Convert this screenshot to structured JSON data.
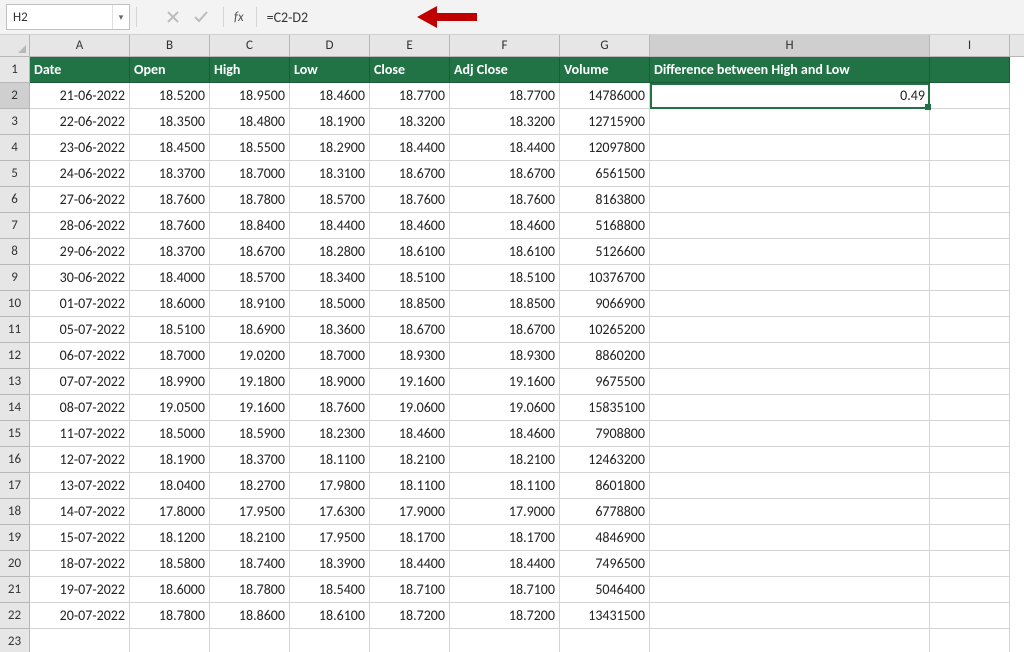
{
  "formula_bar": {
    "name_box": "H2",
    "fx_label": "fx",
    "formula": "=C2-D2"
  },
  "columns": [
    "A",
    "B",
    "C",
    "D",
    "E",
    "F",
    "G",
    "H",
    "I"
  ],
  "row_numbers": [
    "1",
    "2",
    "3",
    "4",
    "5",
    "6",
    "7",
    "8",
    "9",
    "10",
    "11",
    "12",
    "13",
    "14",
    "15",
    "16",
    "17",
    "18",
    "19",
    "20",
    "21",
    "22",
    "23"
  ],
  "headers": {
    "A": "Date",
    "B": "Open",
    "C": "High",
    "D": "Low",
    "E": "Close",
    "F": "Adj Close",
    "G": "Volume",
    "H": "Difference between High and Low"
  },
  "rows": [
    {
      "A": "21-06-2022",
      "B": "18.5200",
      "C": "18.9500",
      "D": "18.4600",
      "E": "18.7700",
      "F": "18.7700",
      "G": "14786000",
      "H": "0.49"
    },
    {
      "A": "22-06-2022",
      "B": "18.3500",
      "C": "18.4800",
      "D": "18.1900",
      "E": "18.3200",
      "F": "18.3200",
      "G": "12715900",
      "H": ""
    },
    {
      "A": "23-06-2022",
      "B": "18.4500",
      "C": "18.5500",
      "D": "18.2900",
      "E": "18.4400",
      "F": "18.4400",
      "G": "12097800",
      "H": ""
    },
    {
      "A": "24-06-2022",
      "B": "18.3700",
      "C": "18.7000",
      "D": "18.3100",
      "E": "18.6700",
      "F": "18.6700",
      "G": "6561500",
      "H": ""
    },
    {
      "A": "27-06-2022",
      "B": "18.7600",
      "C": "18.7800",
      "D": "18.5700",
      "E": "18.7600",
      "F": "18.7600",
      "G": "8163800",
      "H": ""
    },
    {
      "A": "28-06-2022",
      "B": "18.7600",
      "C": "18.8400",
      "D": "18.4400",
      "E": "18.4600",
      "F": "18.4600",
      "G": "5168800",
      "H": ""
    },
    {
      "A": "29-06-2022",
      "B": "18.3700",
      "C": "18.6700",
      "D": "18.2800",
      "E": "18.6100",
      "F": "18.6100",
      "G": "5126600",
      "H": ""
    },
    {
      "A": "30-06-2022",
      "B": "18.4000",
      "C": "18.5700",
      "D": "18.3400",
      "E": "18.5100",
      "F": "18.5100",
      "G": "10376700",
      "H": ""
    },
    {
      "A": "01-07-2022",
      "B": "18.6000",
      "C": "18.9100",
      "D": "18.5000",
      "E": "18.8500",
      "F": "18.8500",
      "G": "9066900",
      "H": ""
    },
    {
      "A": "05-07-2022",
      "B": "18.5100",
      "C": "18.6900",
      "D": "18.3600",
      "E": "18.6700",
      "F": "18.6700",
      "G": "10265200",
      "H": ""
    },
    {
      "A": "06-07-2022",
      "B": "18.7000",
      "C": "19.0200",
      "D": "18.7000",
      "E": "18.9300",
      "F": "18.9300",
      "G": "8860200",
      "H": ""
    },
    {
      "A": "07-07-2022",
      "B": "18.9900",
      "C": "19.1800",
      "D": "18.9000",
      "E": "19.1600",
      "F": "19.1600",
      "G": "9675500",
      "H": ""
    },
    {
      "A": "08-07-2022",
      "B": "19.0500",
      "C": "19.1600",
      "D": "18.7600",
      "E": "19.0600",
      "F": "19.0600",
      "G": "15835100",
      "H": ""
    },
    {
      "A": "11-07-2022",
      "B": "18.5000",
      "C": "18.5900",
      "D": "18.2300",
      "E": "18.4600",
      "F": "18.4600",
      "G": "7908800",
      "H": ""
    },
    {
      "A": "12-07-2022",
      "B": "18.1900",
      "C": "18.3700",
      "D": "18.1100",
      "E": "18.2100",
      "F": "18.2100",
      "G": "12463200",
      "H": ""
    },
    {
      "A": "13-07-2022",
      "B": "18.0400",
      "C": "18.2700",
      "D": "17.9800",
      "E": "18.1100",
      "F": "18.1100",
      "G": "8601800",
      "H": ""
    },
    {
      "A": "14-07-2022",
      "B": "17.8000",
      "C": "17.9500",
      "D": "17.6300",
      "E": "17.9000",
      "F": "17.9000",
      "G": "6778800",
      "H": ""
    },
    {
      "A": "15-07-2022",
      "B": "18.1200",
      "C": "18.2100",
      "D": "17.9500",
      "E": "18.1700",
      "F": "18.1700",
      "G": "4846900",
      "H": ""
    },
    {
      "A": "18-07-2022",
      "B": "18.5800",
      "C": "18.7400",
      "D": "18.3900",
      "E": "18.4400",
      "F": "18.4400",
      "G": "7496500",
      "H": ""
    },
    {
      "A": "19-07-2022",
      "B": "18.6000",
      "C": "18.7800",
      "D": "18.5400",
      "E": "18.7100",
      "F": "18.7100",
      "G": "5046400",
      "H": ""
    },
    {
      "A": "20-07-2022",
      "B": "18.7800",
      "C": "18.8600",
      "D": "18.6100",
      "E": "18.7200",
      "F": "18.7200",
      "G": "13431500",
      "H": ""
    }
  ],
  "selected_cell": "H2",
  "annotation_arrow_color": "#c00000"
}
